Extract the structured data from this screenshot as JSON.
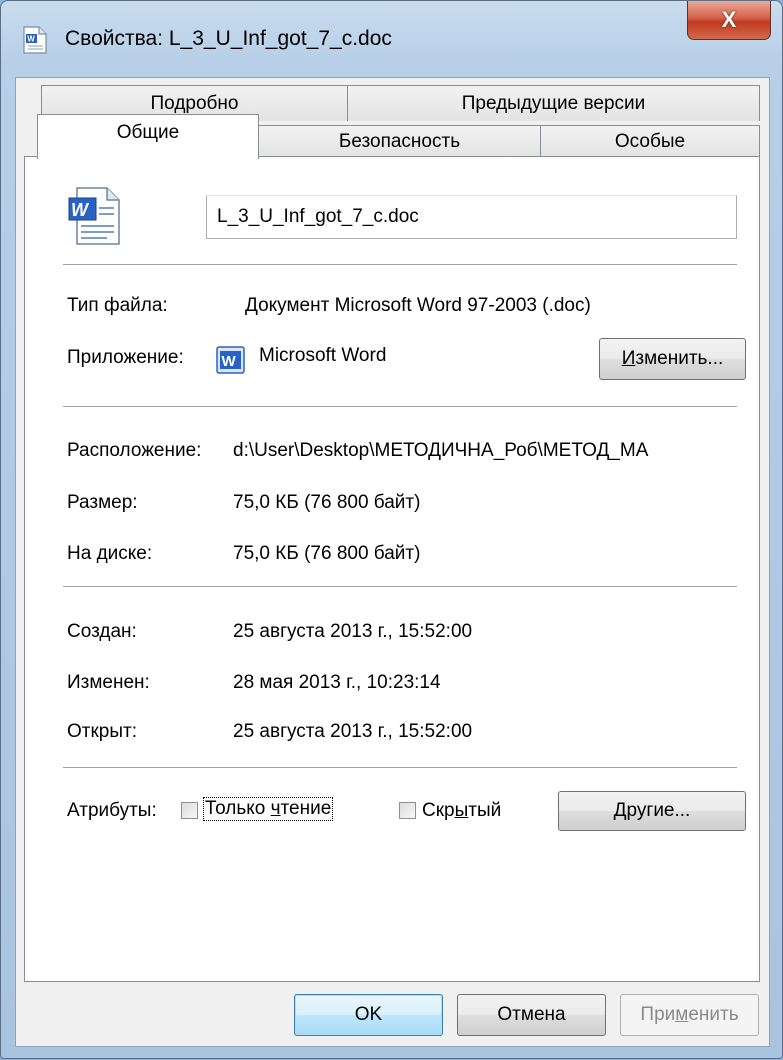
{
  "window": {
    "title": "Свойства: L_3_U_Inf_got_7_c.doc",
    "close_glyph": "X",
    "icon": "word-document-icon"
  },
  "tabs": {
    "row_back": [
      "Подробно",
      "Предыдущие версии"
    ],
    "row_front": [
      "Общие",
      "Безопасность",
      "Особые"
    ],
    "active": "Общие"
  },
  "general": {
    "file_icon": "word-file-icon",
    "filename_value": "L_3_U_Inf_got_7_c.doc",
    "type_label": "Тип файла:",
    "type_value": "Документ Microsoft Word 97-2003 (.doc)",
    "app_label": "Приложение:",
    "app_icon": "word-app-icon",
    "app_value": "Microsoft Word",
    "change_btn_pre": "",
    "change_btn_u": "И",
    "change_btn_post": "зменить...",
    "location_label": "Расположение:",
    "location_value": "d:\\User\\Desktop\\МЕТОДИЧНА_Роб\\МЕТОД_МА",
    "size_label": "Размер:",
    "size_value": "75,0 КБ (76 800 байт)",
    "disk_label": "На диске:",
    "disk_value": "75,0 КБ (76 800 байт)",
    "created_label": "Создан:",
    "created_value": "25 августа 2013 г., 15:52:00",
    "modified_label": "Изменен:",
    "modified_value": "28 мая 2013 г., 10:23:14",
    "opened_label": "Открыт:",
    "opened_value": "25 августа 2013 г., 15:52:00",
    "attributes_label": "Атрибуты:",
    "readonly_pre": "Только ",
    "readonly_u": "ч",
    "readonly_post": "тение",
    "readonly_checked": false,
    "hidden_pre": "Скр",
    "hidden_u": "ы",
    "hidden_post": "тый",
    "hidden_checked": false,
    "other_btn_pre": "",
    "other_btn_u": "Д",
    "other_btn_post": "ругие..."
  },
  "footer": {
    "ok_label": "OK",
    "cancel_label": "Отмена",
    "apply_pre": "При",
    "apply_u": "м",
    "apply_post": "енить"
  }
}
